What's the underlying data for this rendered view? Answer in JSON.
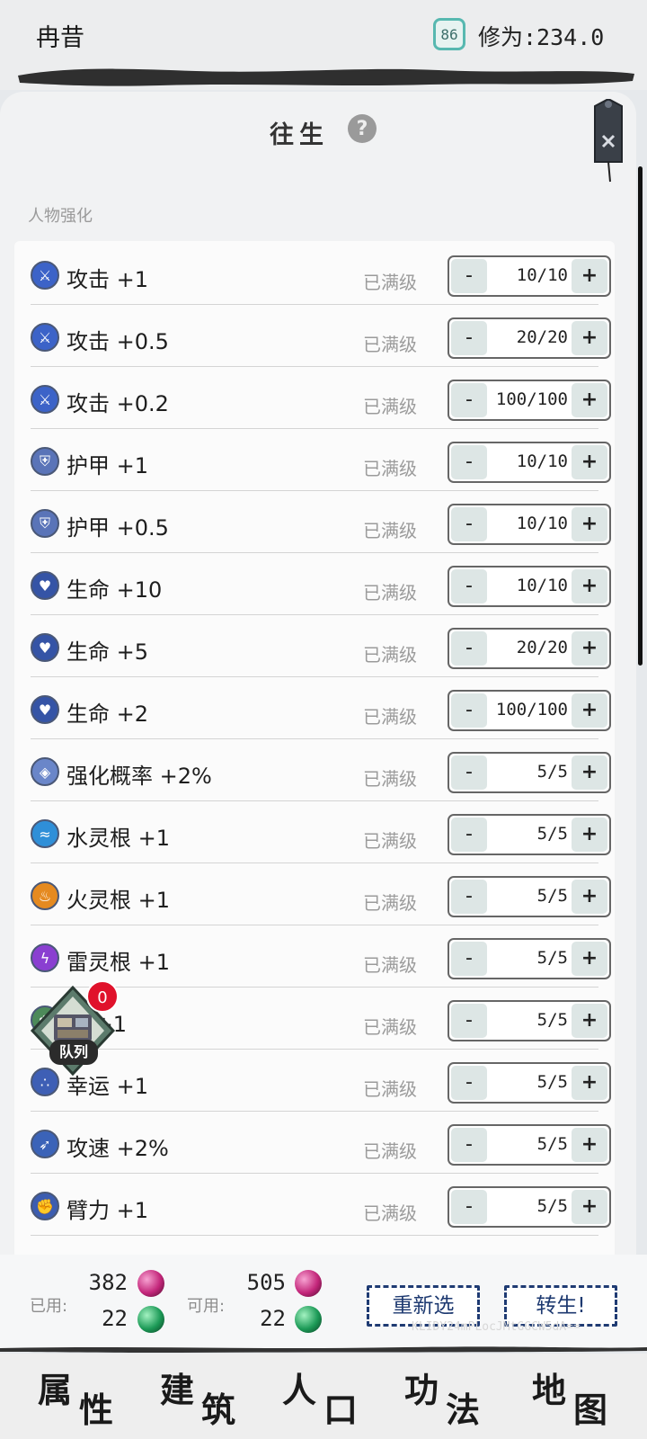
{
  "header": {
    "player_name": "冉昔",
    "cultivation_icon_value": "86",
    "cultivation_label": "修为:234.0"
  },
  "panel": {
    "title": "往生",
    "help_icon": "help-icon",
    "close_icon": "close-icon",
    "section_label": "人物强化"
  },
  "upgrades": [
    {
      "icon": "attack-icon",
      "label": "攻击 +1",
      "status": "已满级",
      "value": "10/10"
    },
    {
      "icon": "attack-icon",
      "label": "攻击 +0.5",
      "status": "已满级",
      "value": "20/20"
    },
    {
      "icon": "attack-icon",
      "label": "攻击 +0.2",
      "status": "已满级",
      "value": "100/100"
    },
    {
      "icon": "armor-icon",
      "label": "护甲 +1",
      "status": "已满级",
      "value": "10/10"
    },
    {
      "icon": "armor-icon",
      "label": "护甲 +0.5",
      "status": "已满级",
      "value": "10/10"
    },
    {
      "icon": "heart-icon",
      "label": "生命 +10",
      "status": "已满级",
      "value": "10/10"
    },
    {
      "icon": "heart-icon",
      "label": "生命 +5",
      "status": "已满级",
      "value": "20/20"
    },
    {
      "icon": "heart-icon",
      "label": "生命 +2",
      "status": "已满级",
      "value": "100/100"
    },
    {
      "icon": "enhance-icon",
      "label": "强化概率 +2%",
      "status": "已满级",
      "value": "5/5"
    },
    {
      "icon": "water-icon",
      "label": "水灵根 +1",
      "status": "已满级",
      "value": "5/5"
    },
    {
      "icon": "fire-icon",
      "label": "火灵根 +1",
      "status": "已满级",
      "value": "5/5"
    },
    {
      "icon": "thunder-icon",
      "label": "雷灵根 +1",
      "status": "已满级",
      "value": "5/5"
    },
    {
      "icon": "root-icon",
      "label": "根 +1",
      "status": "已满级",
      "value": "5/5"
    },
    {
      "icon": "luck-icon",
      "label": "幸运 +1",
      "status": "已满级",
      "value": "5/5"
    },
    {
      "icon": "attack-speed-icon",
      "label": "攻速 +2%",
      "status": "已满级",
      "value": "5/5"
    },
    {
      "icon": "arm-strength-icon",
      "label": "臂力 +1",
      "status": "已满级",
      "value": "5/5"
    }
  ],
  "stepper": {
    "minus": "-",
    "plus": "+"
  },
  "colors": {
    "accent_blue": "#1f3b73",
    "badge_red": "#e0122b",
    "orb_pink": "#c3267a",
    "orb_green": "#1c9a57",
    "teal": "#57b8b0"
  },
  "queue": {
    "badge": "0",
    "label": "队列"
  },
  "footer": {
    "used_label": "已用:",
    "used_pink": "382",
    "used_green": "22",
    "avail_label": "可用:",
    "avail_pink": "505",
    "avail_green": "22",
    "reselect_label": "重新选",
    "rebirth_label": "转生!",
    "watermark": "KLIDY24mPLocJMtGGCW5dA=="
  },
  "nav": [
    {
      "c1": "属",
      "c2": "性"
    },
    {
      "c1": "建",
      "c2": "筑"
    },
    {
      "c1": "人",
      "c2": "口"
    },
    {
      "c1": "功",
      "c2": "法"
    },
    {
      "c1": "地",
      "c2": "图"
    }
  ]
}
